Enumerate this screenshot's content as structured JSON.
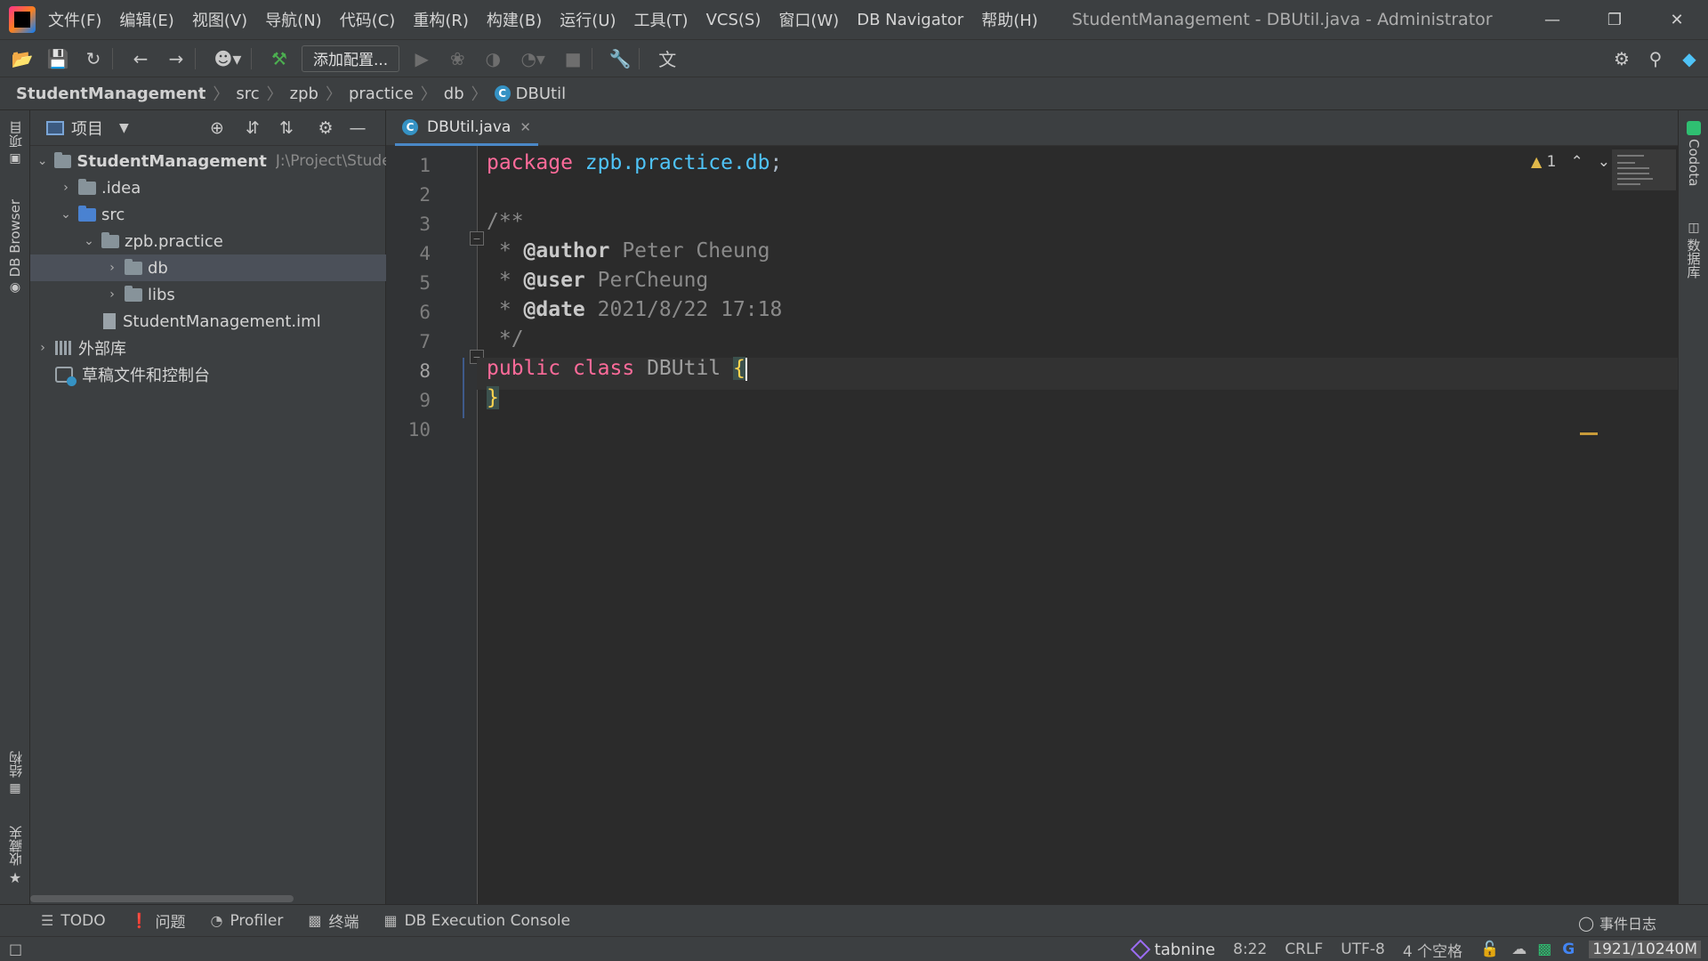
{
  "menu": {
    "items": [
      "文件(F)",
      "编辑(E)",
      "视图(V)",
      "导航(N)",
      "代码(C)",
      "重构(R)",
      "构建(B)",
      "运行(U)",
      "工具(T)",
      "VCS(S)",
      "窗口(W)",
      "DB Navigator",
      "帮助(H)"
    ],
    "window_title": "StudentManagement - DBUtil.java - Administrator"
  },
  "toolbar": {
    "add_config_label": "添加配置..."
  },
  "breadcrumb": [
    "StudentManagement",
    "src",
    "zpb",
    "practice",
    "db",
    "DBUtil"
  ],
  "left_strip": {
    "project_label": "项目",
    "db_browser_label": "DB Browser",
    "structure_label": "结构",
    "favorites_label": "收藏夹"
  },
  "right_strip": {
    "codota_label": "Codota",
    "database_label": "数据库"
  },
  "project_panel": {
    "title": "项目",
    "tree": [
      {
        "label": "StudentManagement",
        "path": "J:\\Project\\Stude",
        "bold": true
      },
      {
        "label": ".idea"
      },
      {
        "label": "src"
      },
      {
        "label": "zpb.practice"
      },
      {
        "label": "db",
        "selected": true
      },
      {
        "label": "libs"
      },
      {
        "label": "StudentManagement.iml"
      },
      {
        "label": "外部库"
      },
      {
        "label": "草稿文件和控制台"
      }
    ]
  },
  "editor": {
    "tab_label": "DBUtil.java",
    "line_numbers": [
      "1",
      "2",
      "3",
      "4",
      "5",
      "6",
      "7",
      "8",
      "9",
      "10"
    ],
    "current_line": "8",
    "warning_count": "1",
    "code": {
      "l1_kw": "package",
      "l1_pkg": "zpb.practice.db",
      "l1_end": ";",
      "l3": "/**",
      "l4_prefix": " * ",
      "l4_tag": "@author",
      "l4_val": " Peter Cheung",
      "l5_prefix": " * ",
      "l5_tag": "@user",
      "l5_val": " PerCheung",
      "l6_prefix": " * ",
      "l6_tag": "@date",
      "l6_val": " 2021/8/22 17:18",
      "l7": " */",
      "l8_kw1": "public",
      "l8_kw2": "class",
      "l8_cls": "DBUtil",
      "l8_brace": "{",
      "l9_brace": "}"
    }
  },
  "bottom_bar": {
    "todo": "TODO",
    "problems": "问题",
    "profiler": "Profiler",
    "terminal": "终端",
    "db_console": "DB Execution Console",
    "event_log": "事件日志"
  },
  "status_bar": {
    "tabnine": "tabnine",
    "position": "8:22",
    "line_sep": "CRLF",
    "encoding": "UTF-8",
    "indent": "4 个空格",
    "memory": "1921/10240M"
  }
}
